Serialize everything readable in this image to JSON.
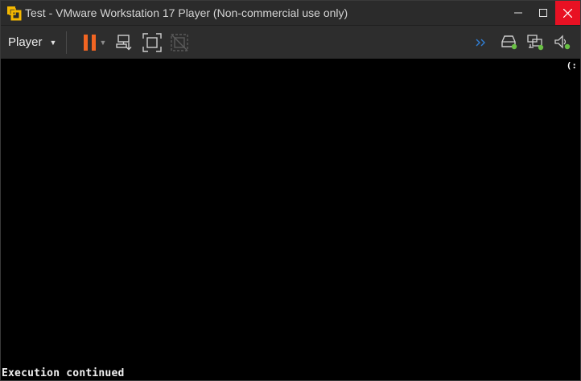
{
  "window": {
    "title": "Test - VMware Workstation 17 Player (Non-commercial use only)",
    "app_icon": "vmware-logo-icon",
    "controls": {
      "minimize": "–",
      "maximize": "□",
      "close": "✕"
    },
    "colors": {
      "titlebar": "#2b2b2b",
      "close_hover": "#e81123",
      "accent_pause": "#f26522",
      "status_green": "#6ac045"
    }
  },
  "toolbar": {
    "player_menu_label": "Player",
    "buttons": [
      "pause-icon",
      "send-ctrl-alt-del-icon",
      "fullscreen-icon",
      "unity-icon"
    ],
    "device_icons": [
      "connect-devices-icon",
      "hard-disk-icon",
      "network-adapter-icon",
      "sound-card-icon"
    ]
  },
  "screen": {
    "corner_text": "(:",
    "console_text": "Execution continued"
  }
}
